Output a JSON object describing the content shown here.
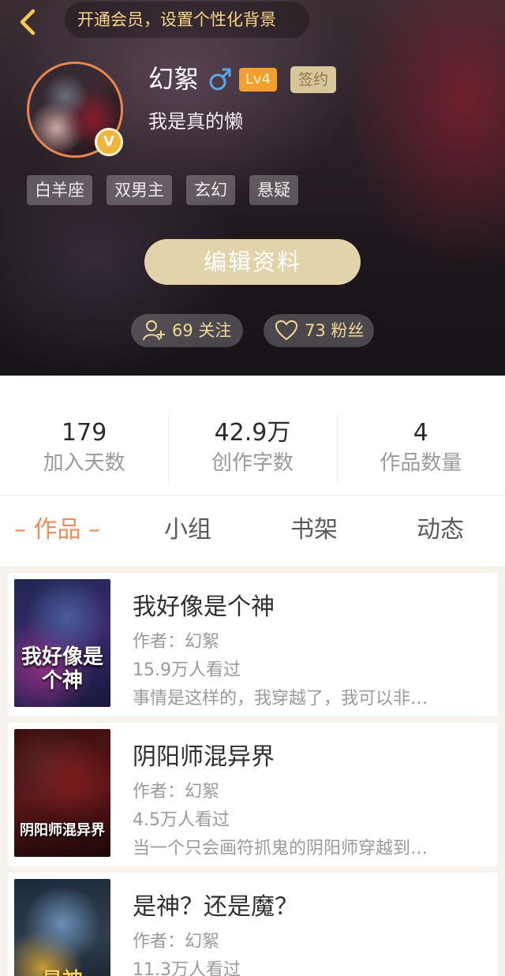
{
  "header": {
    "vip_banner": "开通会员，设置个性化背景",
    "username": "幻絮",
    "level": "Lv4",
    "sign_badge": "签约",
    "bio": "我是真的懒",
    "v_badge": "V",
    "tags": [
      "白羊座",
      "双男主",
      "玄幻",
      "悬疑"
    ],
    "edit_button": "编辑资料",
    "follow_label": "69 关注",
    "fans_label": "73 粉丝"
  },
  "stats": [
    {
      "value": "179",
      "label": "加入天数"
    },
    {
      "value": "42.9万",
      "label": "创作字数"
    },
    {
      "value": "4",
      "label": "作品数量"
    }
  ],
  "tabs": {
    "works": "– 作品 –",
    "group": "小组",
    "shelf": "书架",
    "activity": "动态"
  },
  "books": [
    {
      "title": "我好像是个神",
      "author": "作者：幻絮",
      "reads": "15.9万人看过",
      "summary": "事情是这样的，我穿越了，我可以非…",
      "cover_text": "我好像是个神"
    },
    {
      "title": "阴阳师混异界",
      "author": "作者：幻絮",
      "reads": "4.5万人看过",
      "summary": "当一个只会画符抓鬼的阴阳师穿越到…",
      "cover_text": "阴阳师混异界"
    },
    {
      "title": "是神？还是魔？",
      "author": "作者：幻絮",
      "reads": "11.3万人看过",
      "summary": "",
      "cover_text": "是神"
    }
  ],
  "colors": {
    "accent_orange": "#ef8b5c",
    "gold": "#f3d89a",
    "level_bg": "#f2a02d",
    "edit_button_bg": "#e2d3ab"
  },
  "icons": {
    "back": "chevron-left-icon",
    "gender": "male-icon",
    "follow": "add-user-icon",
    "fans": "heart-icon"
  }
}
